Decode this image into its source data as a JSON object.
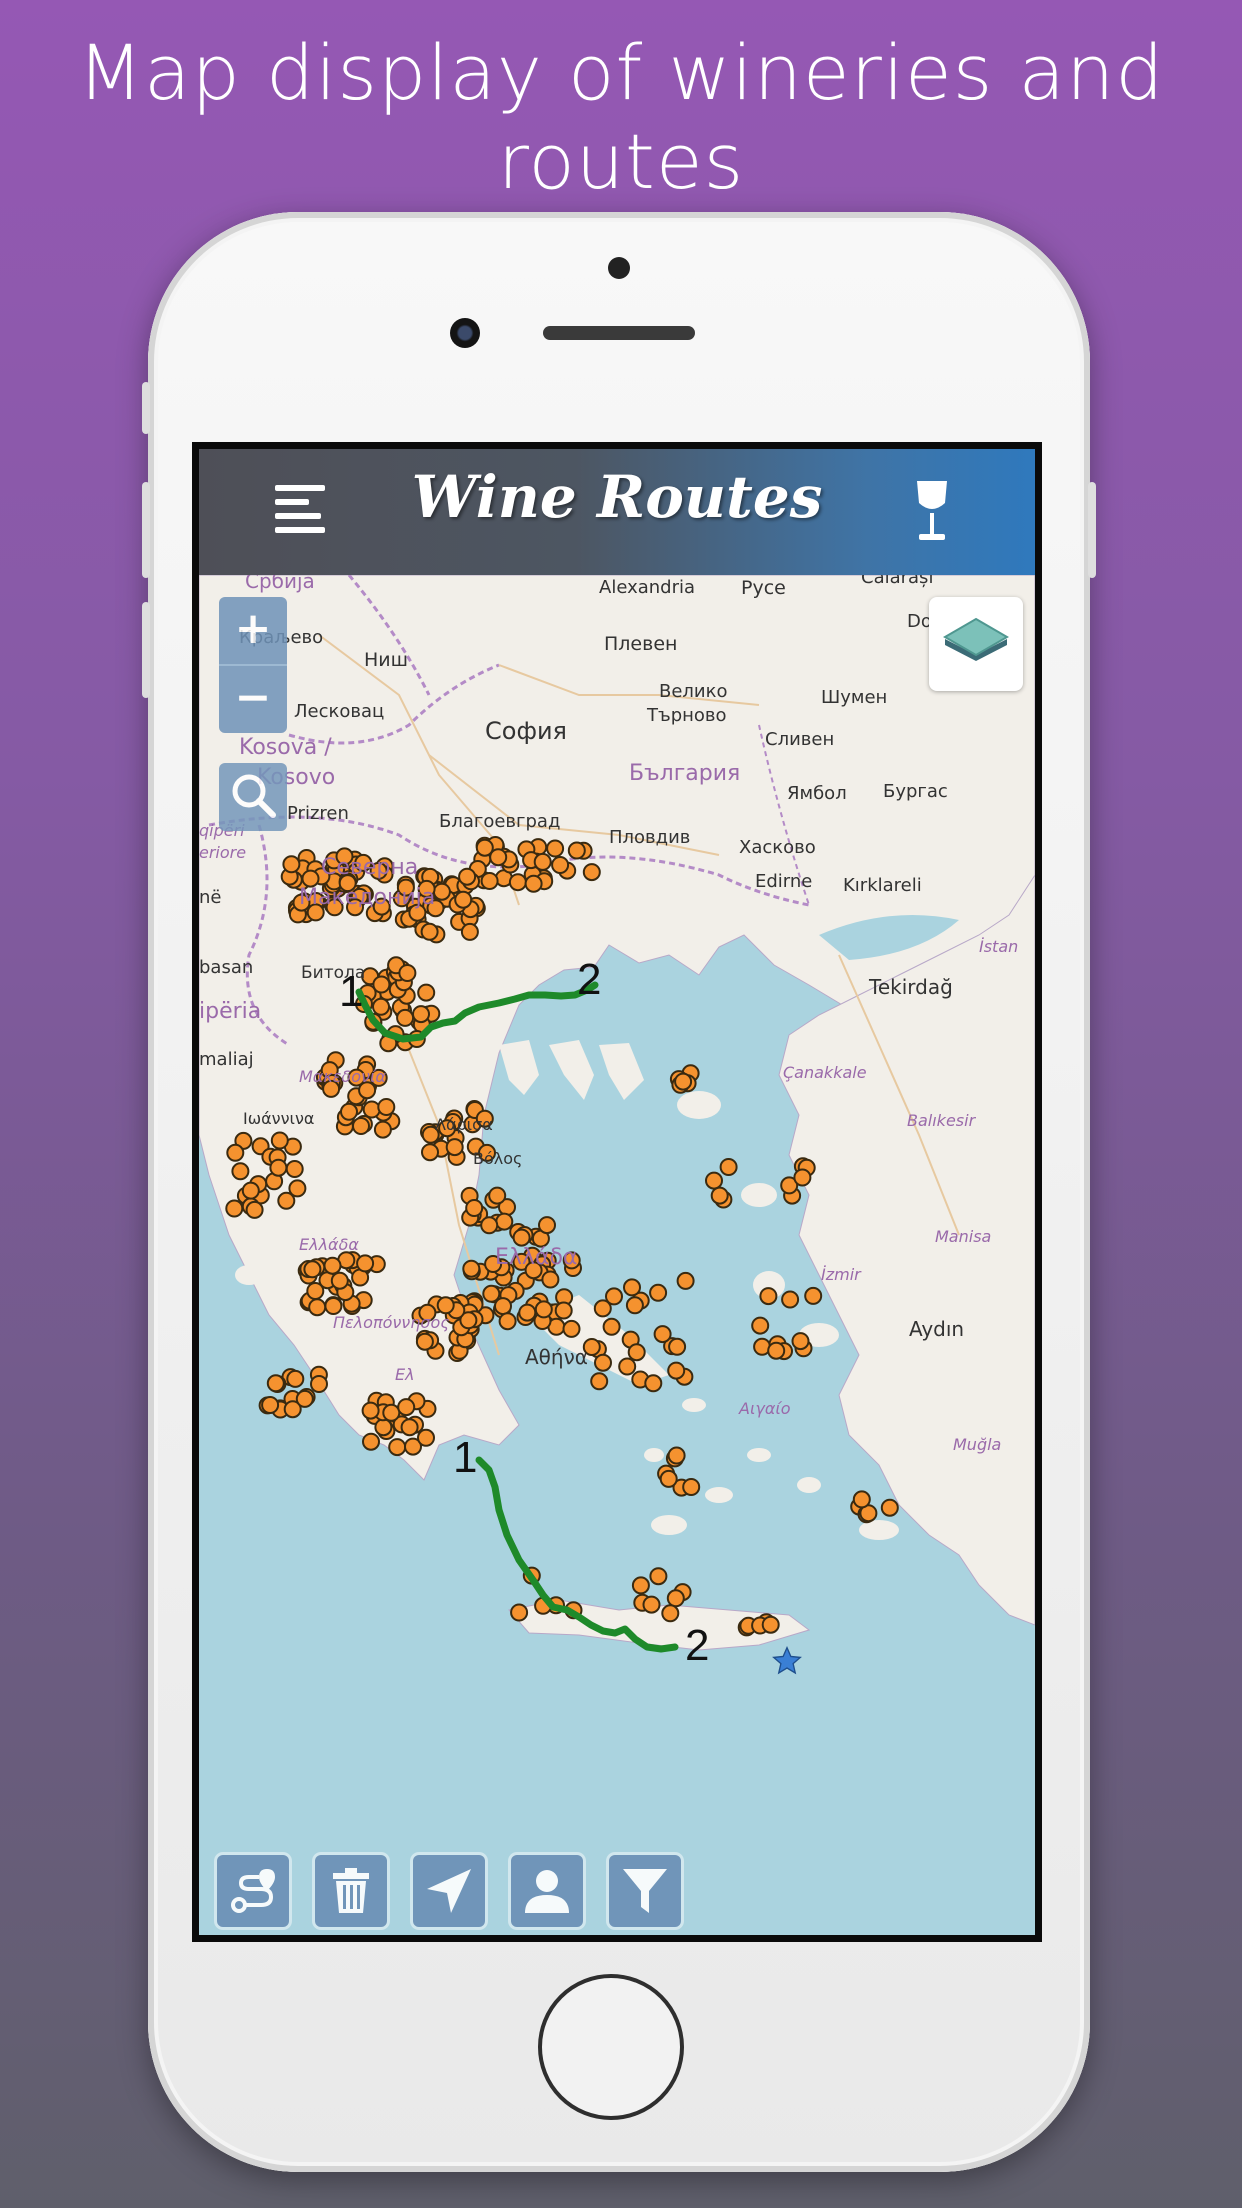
{
  "headline": "Map display of wineries and routes",
  "app": {
    "title": "Wine Routes"
  },
  "icons": {
    "menu": "menu-icon",
    "wine_glass": "wine-glass-icon",
    "zoom_in": "+",
    "zoom_out": "−",
    "search": "search-icon",
    "layers": "layers-icon",
    "route": "route-icon",
    "trash": "trash-icon",
    "locate": "navigation-arrow-icon",
    "user": "user-icon",
    "filter": "filter-icon"
  },
  "map_labels": {
    "srbija": "Србија",
    "kraljevo": "Краљево",
    "nis": "Ниш",
    "leskovac": "Лесковац",
    "kosova": "Kosova /",
    "kosovo": "Kosovo",
    "prizren": "Prizren",
    "alexandria": "Alexandria",
    "ruse": "Русе",
    "calarasi": "Călărași",
    "do": "Do",
    "pleven": "Плевен",
    "veliko": "Велико",
    "tarnovo": "Търново",
    "shumen": "Шумен",
    "sofia": "София",
    "sliven": "Сливен",
    "bulgaria": "България",
    "yambol": "Ямбол",
    "burgas": "Бургас",
    "blagoevgrad": "Благоевград",
    "plovdiv": "Пловдив",
    "haskovo": "Хасково",
    "edirne": "Edirne",
    "kirklareli": "Kırklareli",
    "qiperia_top": "qipëri",
    "eriore": "eriore",
    "severna": "Северна",
    "makedonija": "Македонија",
    "ne": "në",
    "basan": "basan",
    "bitola": "Битола",
    "shqiperia": "ipëria",
    "maliaj": "maliaj",
    "makedonia": "Μακεδονία",
    "ioannina": "Ιωάννινα",
    "larisa": "Λάρισα",
    "volos": "Βόλος",
    "istanbul": "İstan",
    "tekirdag": "Tekirdağ",
    "canakkale": "Çanakkale",
    "balikesir": "Balıkesir",
    "manisa": "Manisa",
    "izmir": "İzmir",
    "aydin": "Aydın",
    "mugla": "Muğla",
    "aigaio": "Αιγαίο",
    "ellada": "Ελλάδα",
    "athina": "Αθήνα",
    "peloponnisos": "Πελοπόννησος",
    "ellada2": "Ελλάδα",
    "el": "Ελ"
  },
  "routes": [
    {
      "start_marker": "1",
      "end_marker": "2"
    },
    {
      "start_marker": "1",
      "end_marker": "2"
    }
  ],
  "colors": {
    "winery_marker": "#f5922f",
    "route_line": "#1e8a2a",
    "sea": "#aad3df",
    "land": "#f2efe9",
    "appbar_left": "#4e4f57",
    "appbar_right": "#2f79bd",
    "background_top": "#9558b4",
    "background_bottom": "#5f5f6b"
  }
}
